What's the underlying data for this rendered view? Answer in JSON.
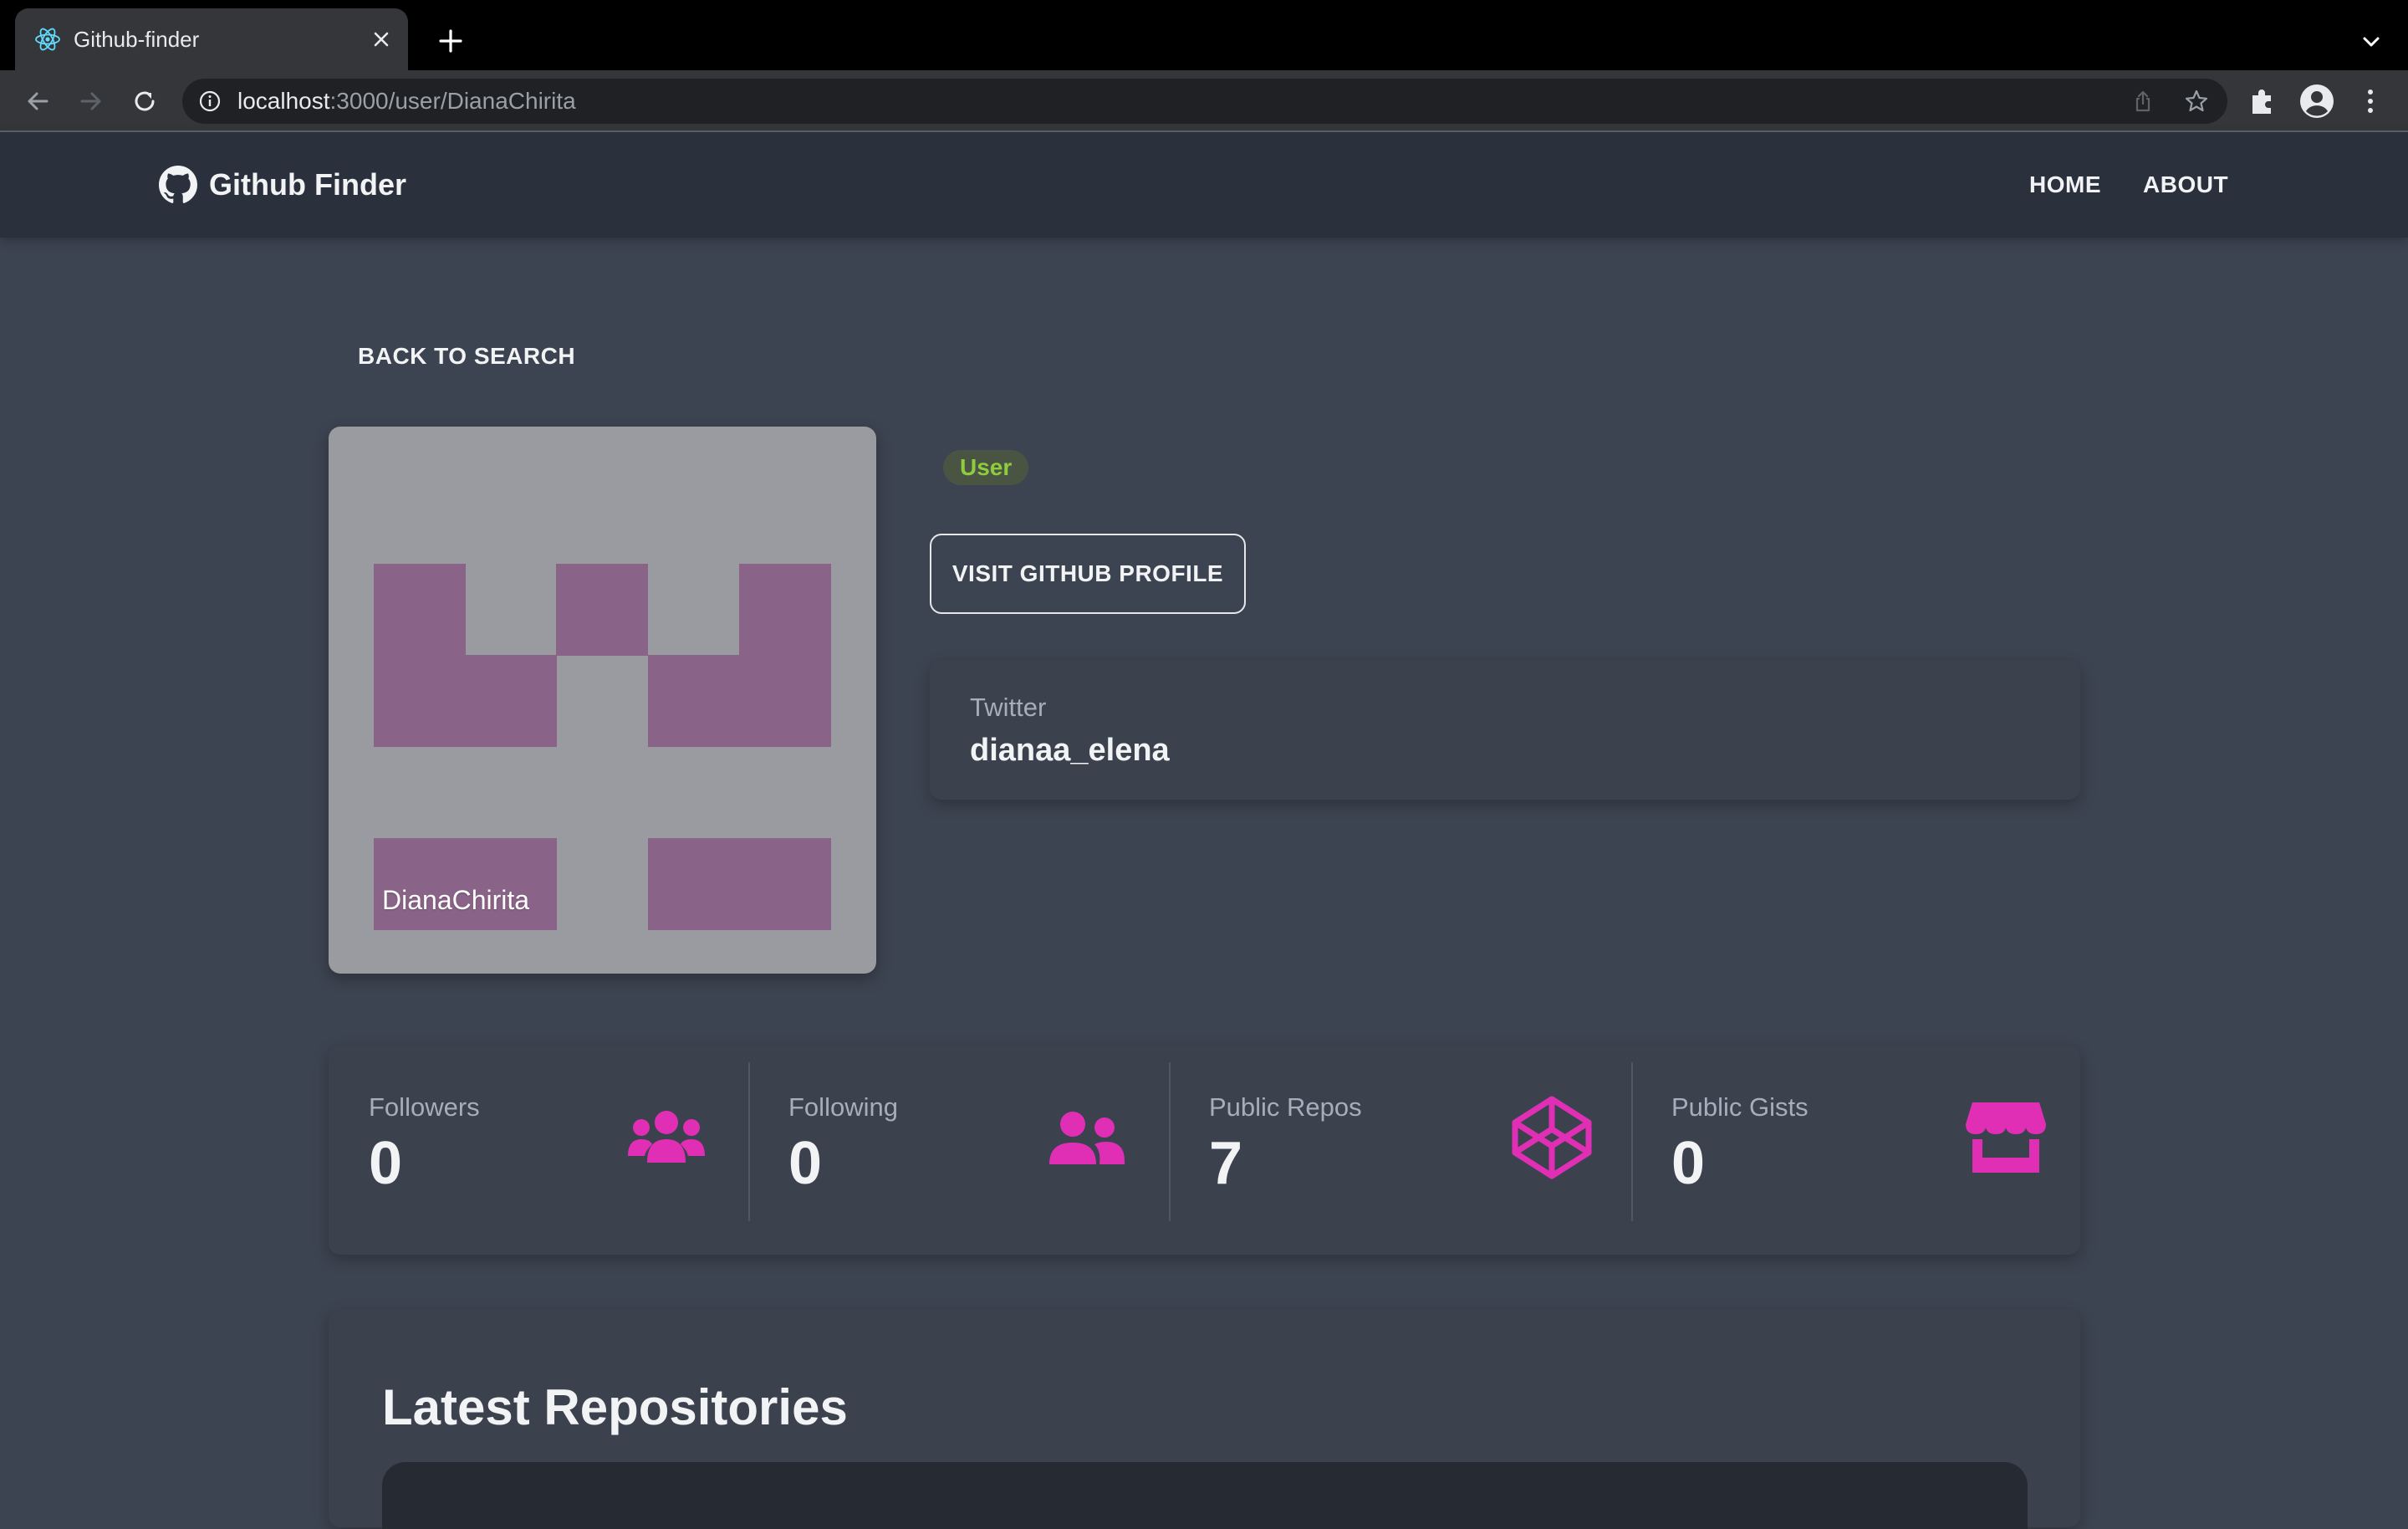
{
  "browser": {
    "tab_title": "Github-finder",
    "url_host": "localhost",
    "url_rest": ":3000/user/DianaChirita"
  },
  "navbar": {
    "brand": "Github Finder",
    "links": [
      "HOME",
      "ABOUT"
    ]
  },
  "profile": {
    "back_label": "BACK TO SEARCH",
    "login": "DianaChirita",
    "type_badge": "User",
    "visit_label": "VISIT GITHUB PROFILE",
    "twitter_label": "Twitter",
    "twitter_value": "dianaa_elena"
  },
  "stats": [
    {
      "title": "Followers",
      "value": "0",
      "icon": "users-icon"
    },
    {
      "title": "Following",
      "value": "0",
      "icon": "user-friends-icon"
    },
    {
      "title": "Public Repos",
      "value": "7",
      "icon": "codepen-icon"
    },
    {
      "title": "Public Gists",
      "value": "0",
      "icon": "store-icon"
    }
  ],
  "repos": {
    "title": "Latest Repositories"
  },
  "colors": {
    "accent": "#e02fb5",
    "badge_text": "#8fcb3f",
    "avatar_bg": "#999ba0",
    "avatar_fg": "#8a6488",
    "page_bg": "#3d4451",
    "nav_bg": "#2a303c"
  }
}
